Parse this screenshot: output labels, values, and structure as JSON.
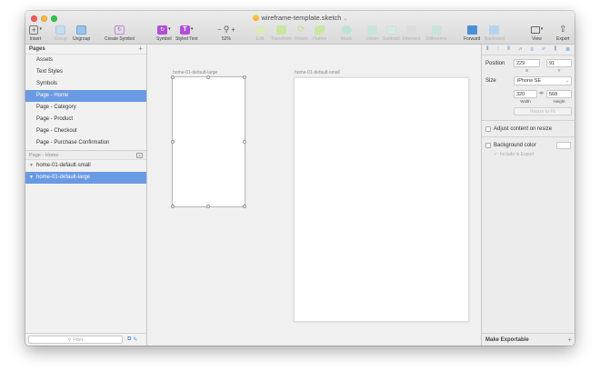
{
  "window": {
    "title": "wireframe-template.sketch"
  },
  "toolbar": {
    "insert": "Insert",
    "group": "Group",
    "ungroup": "Ungroup",
    "create_symbol": "Create Symbol",
    "symbol": "Symbol",
    "styled_text": "Styled Text",
    "zoom_minus": "−",
    "zoom_plus": "+",
    "zoom_level": "52%",
    "edit": "Edit",
    "transform": "Transform",
    "rotate": "Rotate",
    "flatten": "Flatten",
    "mask": "Mask",
    "union": "Union",
    "subtract": "Subtract",
    "intersect": "Intersect",
    "difference": "Difference",
    "forward": "Forward",
    "backward": "Backward",
    "view": "View",
    "export": "Export"
  },
  "sidebar": {
    "pages_header": "Pages",
    "pages": [
      {
        "label": "Assets"
      },
      {
        "label": "Text Styles"
      },
      {
        "label": "Symbols"
      },
      {
        "label": "Page - Home"
      },
      {
        "label": "Page - Category"
      },
      {
        "label": "Page - Product"
      },
      {
        "label": "Page - Checkout"
      },
      {
        "label": "Page - Purchase Confirmation"
      }
    ],
    "selected_page": "Page - Home",
    "layers_header": "Page - Home",
    "layers": [
      {
        "label": "home-01-default-small"
      },
      {
        "label": "home-01-default-large"
      }
    ],
    "filter_placeholder": "Filter"
  },
  "canvas": {
    "artboards": [
      {
        "label": "home-01-default-large"
      },
      {
        "label": "home-01-default-small"
      }
    ]
  },
  "inspector": {
    "position_label": "Position",
    "x_value": "229",
    "y_value": "91",
    "x_label": "X",
    "y_label": "Y",
    "size_label": "Size",
    "device_value": "iPhone SE",
    "width_value": "320",
    "height_value": "568",
    "width_label": "Width",
    "height_label": "Height",
    "resize_to_fit": "Resize to Fit",
    "adjust_content": "Adjust content on resize",
    "background_color": "Background color",
    "include_in_export": "Include in Export",
    "make_exportable": "Make Exportable"
  },
  "colors": {
    "selection": "#6a9ae3",
    "accent_blue": "#4a90d9",
    "canvas_bg": "#f0f0f0"
  }
}
